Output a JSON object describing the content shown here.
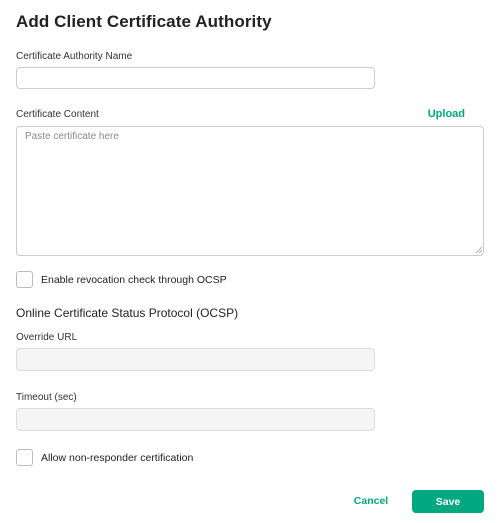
{
  "dialog": {
    "title": "Add Client Certificate Authority"
  },
  "ca_name": {
    "label": "Certificate Authority Name",
    "value": ""
  },
  "cert_content": {
    "label": "Certificate Content",
    "upload_label": "Upload",
    "placeholder": "Paste certificate here",
    "value": ""
  },
  "ocsp_toggle": {
    "label": "Enable revocation check through OCSP",
    "checked": false
  },
  "ocsp_section": {
    "heading": "Online Certificate Status Protocol (OCSP)",
    "override_url": {
      "label": "Override URL",
      "value": ""
    },
    "timeout": {
      "label": "Timeout (sec)",
      "value": ""
    },
    "non_responder": {
      "label": "Allow non-responder certification",
      "checked": false
    }
  },
  "footer": {
    "cancel_label": "Cancel",
    "save_label": "Save"
  },
  "colors": {
    "accent": "#01a982"
  }
}
